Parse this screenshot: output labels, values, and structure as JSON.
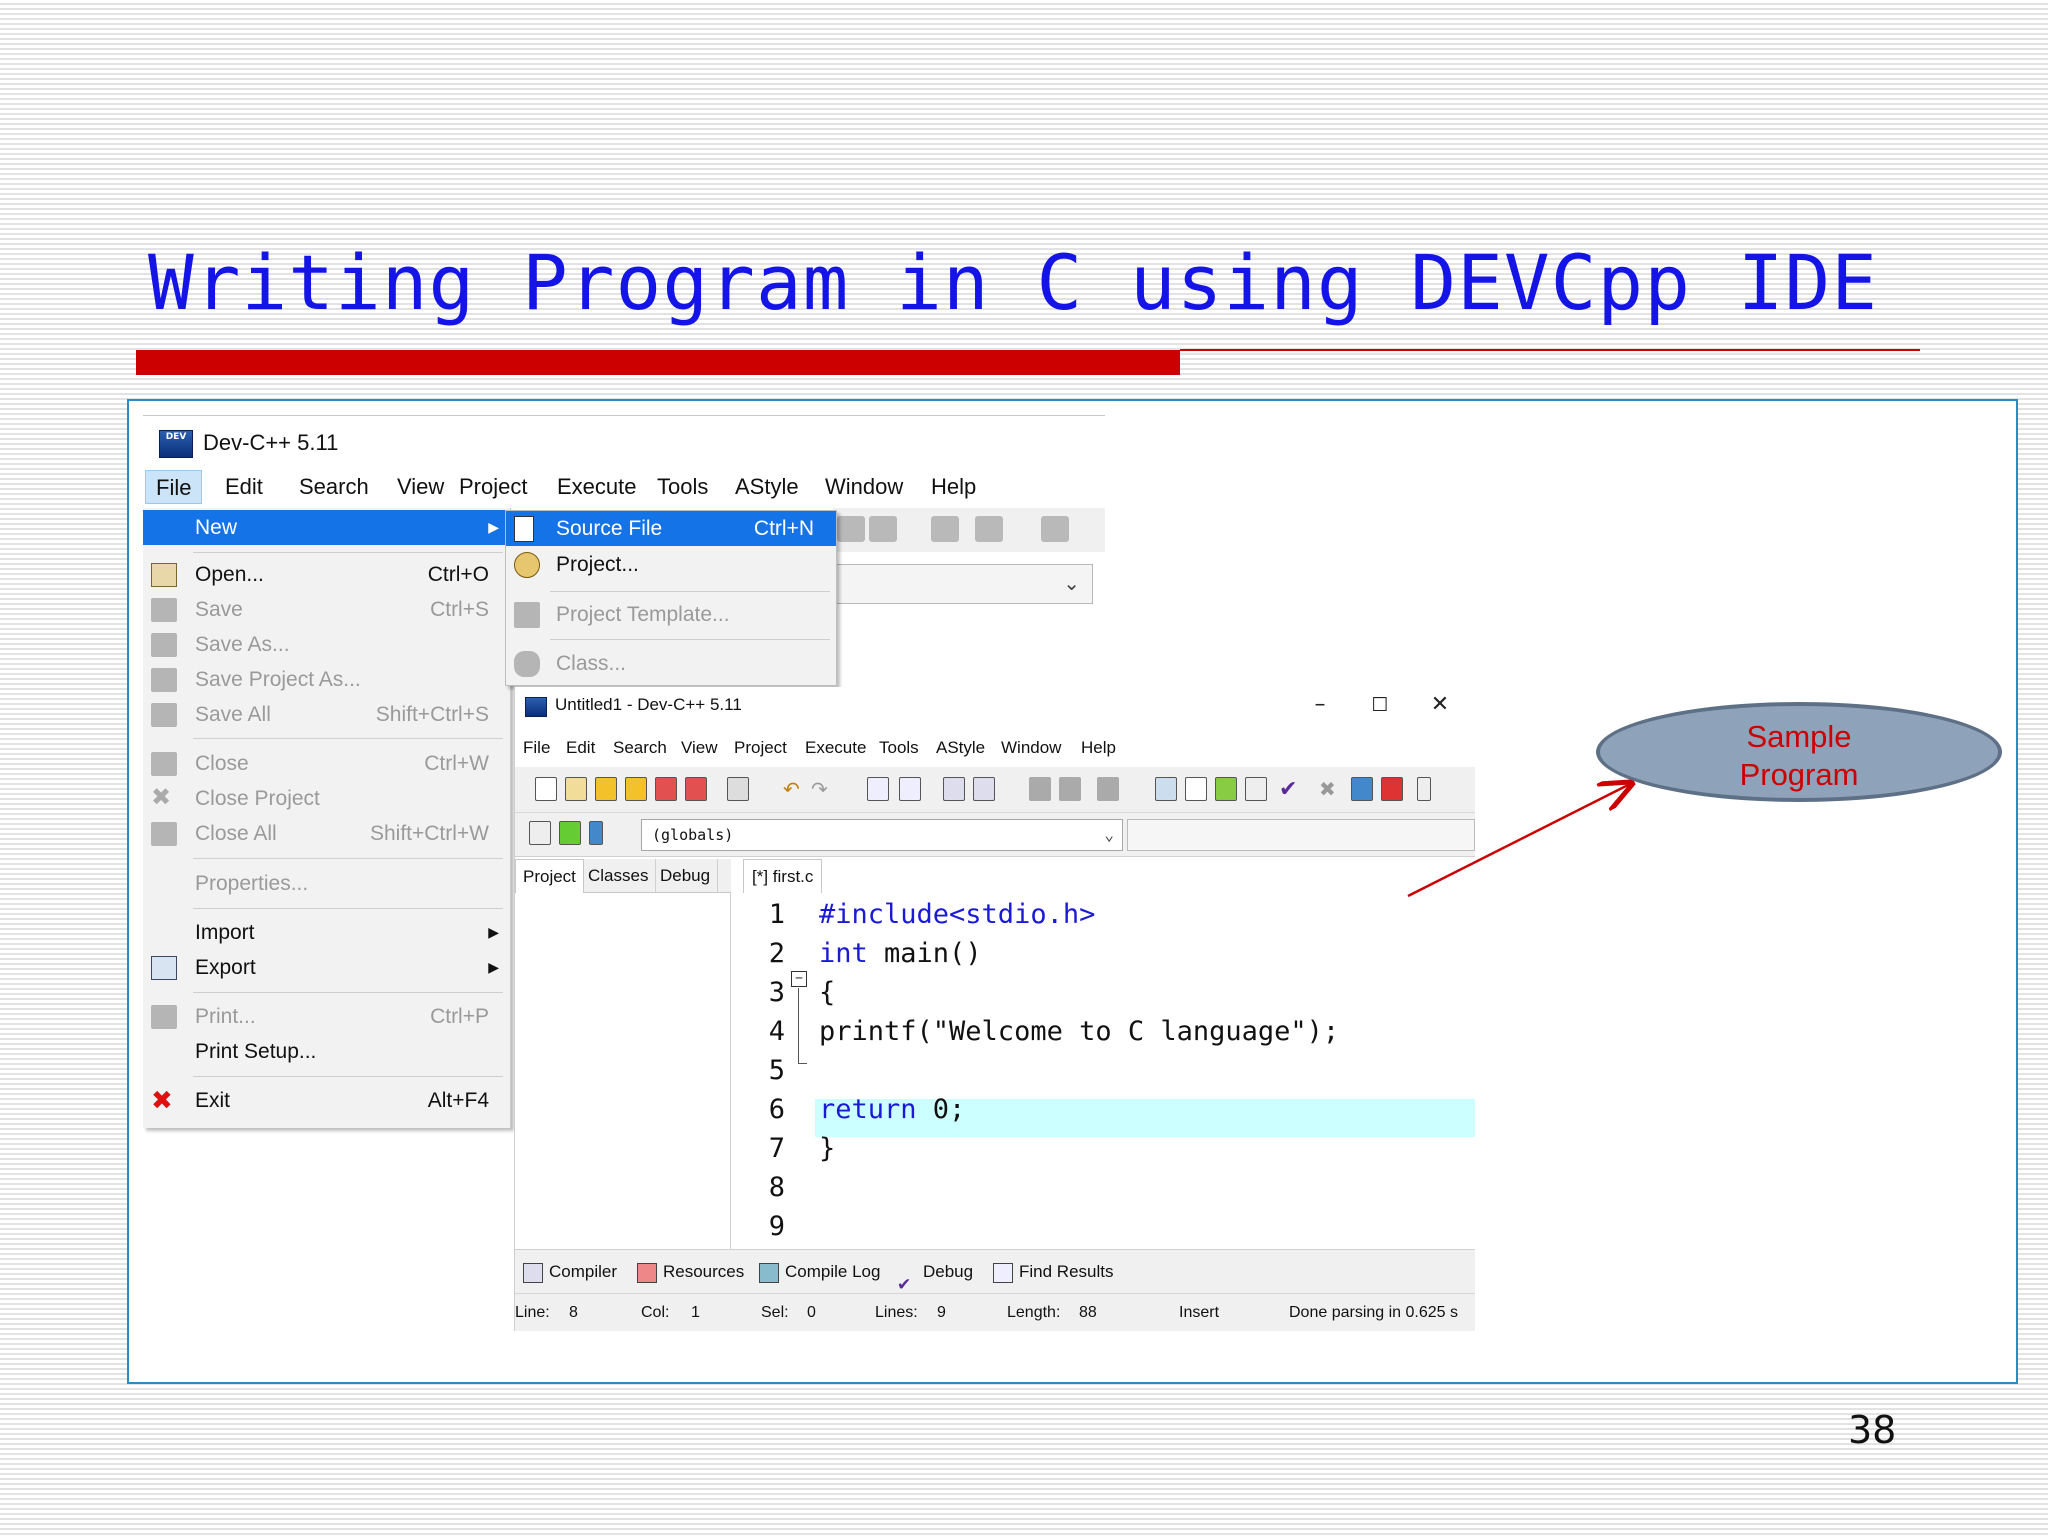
{
  "slide": {
    "title": "Writing Program in C using DEVCpp IDE",
    "page_number": "38",
    "callout_line1": "Sample",
    "callout_line2": "Program"
  },
  "window1": {
    "title": "Dev-C++ 5.11",
    "icon_text": "DEV",
    "menu": [
      "File",
      "Edit",
      "Search",
      "View",
      "Project",
      "Execute",
      "Tools",
      "AStyle",
      "Window",
      "Help"
    ],
    "file_menu": {
      "new": "New",
      "open": "Open...",
      "open_sc": "Ctrl+O",
      "save": "Save",
      "save_sc": "Ctrl+S",
      "save_as": "Save As...",
      "save_project_as": "Save Project As...",
      "save_all": "Save All",
      "save_all_sc": "Shift+Ctrl+S",
      "close": "Close",
      "close_sc": "Ctrl+W",
      "close_project": "Close Project",
      "close_all": "Close All",
      "close_all_sc": "Shift+Ctrl+W",
      "properties": "Properties...",
      "import": "Import",
      "export": "Export",
      "print": "Print...",
      "print_sc": "Ctrl+P",
      "print_setup": "Print Setup...",
      "exit": "Exit",
      "exit_sc": "Alt+F4"
    },
    "sub_menu": {
      "source_file": "Source File",
      "source_file_sc": "Ctrl+N",
      "project": "Project...",
      "project_template": "Project Template...",
      "class": "Class..."
    }
  },
  "window2": {
    "title": "Untitled1 - Dev-C++ 5.11",
    "icon_text": "DEV",
    "menu": [
      "File",
      "Edit",
      "Search",
      "View",
      "Project",
      "Execute",
      "Tools",
      "AStyle",
      "Window",
      "Help"
    ],
    "globals": "(globals)",
    "left_tabs": [
      "Project",
      "Classes",
      "Debug"
    ],
    "editor_tab": "[*] first.c",
    "line_numbers": [
      "1",
      "2",
      "3",
      "4",
      "5",
      "6",
      "7",
      "8",
      "9"
    ],
    "code": {
      "l1": "#include<stdio.h>",
      "l2_kw": "int",
      "l2_rest": " main()",
      "l3": "{",
      "l4": "printf(\"Welcome to C language\");",
      "l6_kw": "return",
      "l6_rest": " 0;",
      "l7": "}"
    },
    "bottom_tabs": [
      "Compiler",
      "Resources",
      "Compile Log",
      "Debug",
      "Find Results"
    ],
    "status": {
      "line_label": "Line:",
      "line_val": "8",
      "col_label": "Col:",
      "col_val": "1",
      "sel_label": "Sel:",
      "sel_val": "0",
      "lines_label": "Lines:",
      "lines_val": "9",
      "length_label": "Length:",
      "length_val": "88",
      "mode": "Insert",
      "message": "Done parsing in 0.625 s"
    },
    "controls": {
      "minimize": "–",
      "maximize": "☐",
      "close": "✕"
    }
  }
}
